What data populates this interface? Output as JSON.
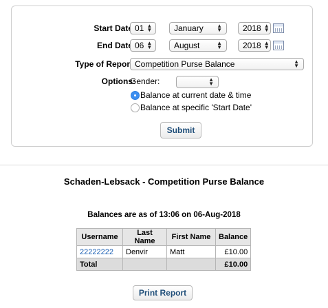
{
  "form": {
    "start_date": {
      "label": "Start Date:",
      "day": "01",
      "month": "January",
      "year": "2018"
    },
    "end_date": {
      "label": "End Date:",
      "day": "06",
      "month": "August",
      "year": "2018"
    },
    "report_type": {
      "label": "Type of Report:",
      "value": "Competition Purse Balance"
    },
    "options": {
      "label": "Options:",
      "gender_label": "Gender:",
      "gender_value": "",
      "radio_current": "Balance at current date & time",
      "radio_specific": "Balance at specific 'Start Date'",
      "selected": "current"
    },
    "submit_label": "Submit"
  },
  "report": {
    "title": "Schaden-Lebsack - Competition Purse Balance",
    "as_of": "Balances are as of 13:06 on 06-Aug-2018",
    "columns": [
      "Username",
      "Last Name",
      "First Name",
      "Balance"
    ],
    "rows": [
      {
        "username": "22222222",
        "last_name": "Denvir",
        "first_name": "Matt",
        "balance": "£10.00"
      }
    ],
    "total": {
      "label": "Total",
      "balance": "£10.00"
    },
    "print_label": "Print Report"
  }
}
